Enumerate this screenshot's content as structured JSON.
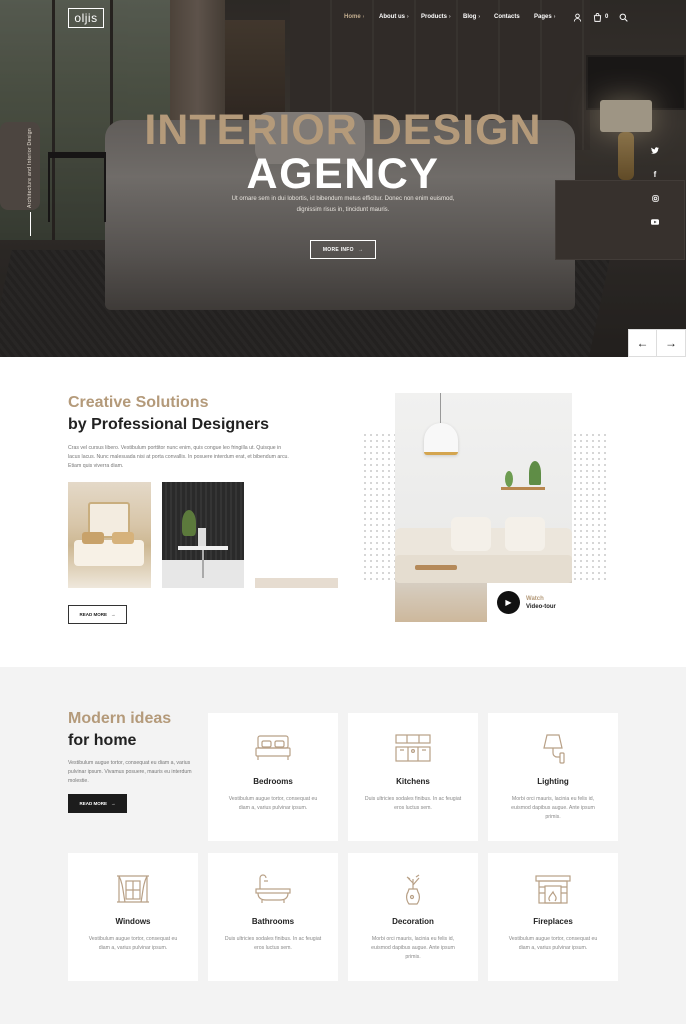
{
  "brand": {
    "logo": "oljis"
  },
  "nav": {
    "items": [
      {
        "label": "Home",
        "active": true
      },
      {
        "label": "About us",
        "active": false
      },
      {
        "label": "Products",
        "active": false
      },
      {
        "label": "Blog",
        "active": false
      },
      {
        "label": "Contacts",
        "active": false
      },
      {
        "label": "Pages",
        "active": false
      }
    ],
    "cart_count": "0",
    "icons": [
      "user-icon",
      "cart-icon",
      "search-icon"
    ]
  },
  "hero": {
    "side_text": "Architecture and Interior Design",
    "title_line1": "INTERIOR DESIGN",
    "title_line2": "AGENCY",
    "text": "Ut ornare sem in dui lobortis, id bibendum metus efficitur. Donec non enim euismod, dignissim risus in, tincidunt mauris.",
    "button": "MORE INFO",
    "social": [
      "twitter-icon",
      "facebook-icon",
      "instagram-icon",
      "youtube-icon"
    ],
    "colors": {
      "accent": "#b49a7a"
    }
  },
  "creative": {
    "title_line1": "Creative Solutions",
    "title_line2": "by Professional Designers",
    "text": "Cras vel cursus libero. Vestibulum porttitor nunc enim, quis congue leo fringilla ut. Quisque in lacus lacus. Nunc malesuada nisi at porta convallis. In posuere interdum erat, et bibendum arcu. Etiam quis viverra diam.",
    "button": "READ MORE",
    "video_watch": "Watch",
    "video_label": "Video-tour"
  },
  "ideas": {
    "title_line1": "Modern ideas",
    "title_line2": "for home",
    "text": "Vestibulum augue tortor, consequat eu diam a, varius pulvinar ipsum. Vivamus posuere, mauris eu interdum molestie.",
    "button": "READ MORE",
    "cards": [
      {
        "title": "Bedrooms",
        "desc": "Vestibulum augue tortor, consequat eu diam a, varius pulvinar ipsum.",
        "icon": "bed-icon"
      },
      {
        "title": "Kitchens",
        "desc": "Duis ultricies sodales finibus. In ac feugiat eros luctus sem.",
        "icon": "kitchen-icon"
      },
      {
        "title": "Lighting",
        "desc": "Morbi orci mauris, lacinia eu felis id, euismod dapibus augue. Ante ipsum primis.",
        "icon": "wall-lamp-icon"
      },
      {
        "title": "Windows",
        "desc": "Vestibulum augue tortor, consequat eu diam a, varius pulvinar ipsum.",
        "icon": "window-curtains-icon"
      },
      {
        "title": "Bathrooms",
        "desc": "Duis ultricies sodales finibus. In ac feugiat eros luctus sem.",
        "icon": "bathtub-icon"
      },
      {
        "title": "Decoration",
        "desc": "Morbi orci mauris, lacinia eu felis id, euismod dapibus augue. Ante ipsum primis.",
        "icon": "vase-icon"
      },
      {
        "title": "Fireplaces",
        "desc": "Vestibulum augue tortor, consequat eu diam a, varius pulvinar ipsum.",
        "icon": "fireplace-icon"
      }
    ]
  }
}
